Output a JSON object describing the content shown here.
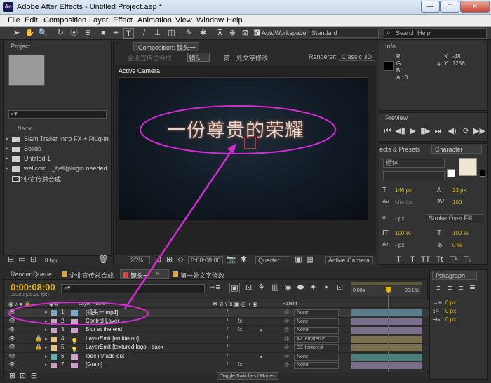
{
  "window": {
    "app_badge": "Ae",
    "title": "Adobe After Effects - Untitled Project.aep *",
    "minimize": "—",
    "maximize": "□",
    "close": "✕"
  },
  "menu": [
    "File",
    "Edit",
    "Composition",
    "Layer",
    "Effect",
    "Animation",
    "View",
    "Window",
    "Help"
  ],
  "toolbar": {
    "autoworkspace_label": "AutoWorkspace:",
    "workspace_value": "Standard",
    "search_placeholder": "Search Help"
  },
  "project_panel": {
    "tab": "Project",
    "search_icon": "⌕▾",
    "name_header": "Name",
    "items": [
      {
        "label": "Slam Trailer Intro FX + Plug-in",
        "type": "folder"
      },
      {
        "label": "Solids",
        "type": "folder"
      },
      {
        "label": "Untitled 1",
        "type": "folder"
      },
      {
        "label": "wellcom..._hell(plugin needed",
        "type": "folder"
      },
      {
        "label": "企业宣传总合成",
        "type": "comp"
      }
    ],
    "bpc": "8 bpc"
  },
  "composition_panel": {
    "tab": "Composition: 镜头一",
    "breadcrumbs": [
      "企业宣传总合成",
      "镜头一",
      "第一处文字修改"
    ],
    "renderer_label": "Renderer:",
    "renderer_value": "Classic 3D",
    "viewer_label": "Active Camera",
    "canvas_text": "一份尊贵的荣耀",
    "zoom": "25%",
    "timecode": "0:00:08:00",
    "resolution": "Quarter",
    "view": "Active Camera"
  },
  "info_panel": {
    "tab": "Info",
    "channels": [
      "R :",
      "G :",
      "B :",
      "A : 0"
    ],
    "x_label": "X : -48",
    "y_label": "Y : 1256"
  },
  "preview_panel": {
    "tab": "Preview"
  },
  "effects_tab": "ects & Presets",
  "character_panel": {
    "tab": "Character",
    "font": "楷体",
    "size": "146 px",
    "leading": "23 px",
    "kerning": "Metrics",
    "tracking": "100",
    "stroke_width": "- px",
    "stroke_type": "Stroke Over Fill",
    "vscale": "100 %",
    "hscale": "100 %",
    "baseline": "- px",
    "tsume": "0 %"
  },
  "paragraph_panel": {
    "tab": "Paragraph",
    "indents": [
      "0 px",
      "0 px",
      "0 px"
    ]
  },
  "timeline": {
    "tabs": [
      "Render Queue",
      "企业宣传总合成",
      "镜头一",
      "第一处文字修改"
    ],
    "timecode": "0:00:08:00",
    "fps": "00200 (25.00 fps)",
    "layer_name_header": "Layer Name",
    "parent_header": "Parent",
    "ruler_start": "0:00s",
    "ruler_end": "00:15s",
    "toggle_label": "Toggle Switches / Modes",
    "layers": [
      {
        "num": "1",
        "name": "[镜头一.mp4]",
        "color": "#7aa7c7",
        "parent": "None"
      },
      {
        "num": "2",
        "name": "Control Layer",
        "color": "#c8a2c8",
        "parent": "None"
      },
      {
        "num": "3",
        "name": "Blur at the end",
        "color": "#c8a2c8",
        "parent": "None"
      },
      {
        "num": "4",
        "name": "LayerEmit [emitterup]",
        "color": "#e8c07a",
        "parent": "47. emitterup"
      },
      {
        "num": "5",
        "name": "LayerEmit [textured logo - back",
        "color": "#e8c07a",
        "parent": "33. textured"
      },
      {
        "num": "6",
        "name": "fade in/fade out",
        "color": "#4fb9b3",
        "parent": "None"
      },
      {
        "num": "7",
        "name": "[Grain]",
        "color": "#c8a2c8",
        "parent": "None"
      }
    ]
  },
  "colors": {
    "annotation": "#d52bd5",
    "timecode": "#e8b400",
    "playhead": "#d43a3a"
  }
}
